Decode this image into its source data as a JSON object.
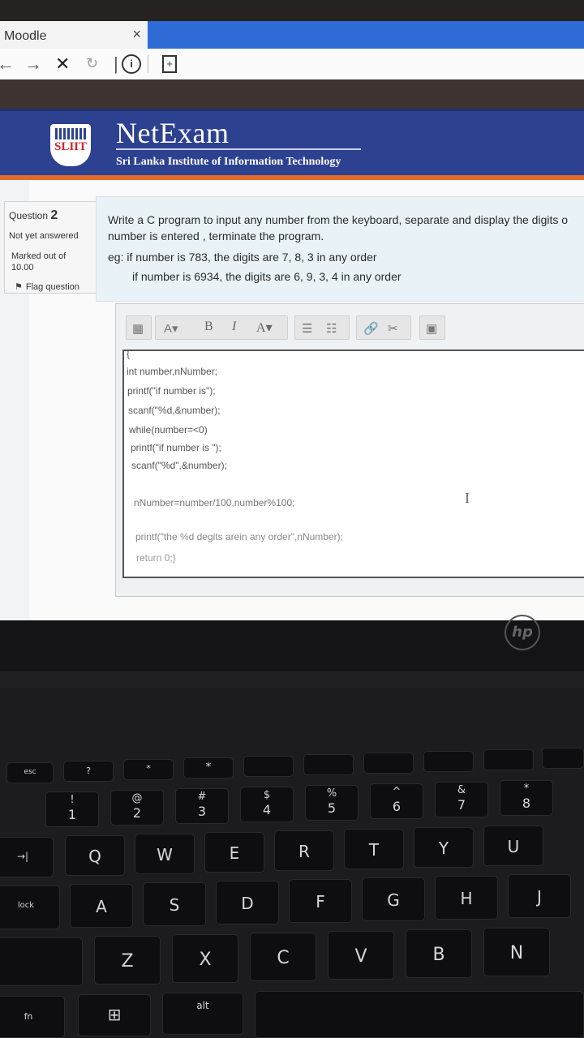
{
  "browser": {
    "tab_title": "Moodle",
    "close_glyph": "×",
    "nav_icons": [
      "back-arrow-icon",
      "forward-arrow-icon",
      "stop-icon",
      "reload-icon",
      "info-icon",
      "bookmark-add-icon"
    ]
  },
  "header": {
    "logo_text": "SLIIT",
    "brand": "NetExam",
    "subtitle": "Sri Lanka Institute of Information Technology",
    "colors": {
      "banner": "#2d4191",
      "accent": "#e16b2a"
    }
  },
  "question_info": {
    "label": "Question",
    "number": "2",
    "state": "Not yet answered",
    "marked": "Marked out of",
    "marks": "10.00",
    "flag": "Flag question"
  },
  "question": {
    "line1": "Write a C program to input any number from the keyboard, separate and display the digits o",
    "line2": "number is entered , terminate the program.",
    "example1": "eg: if number is 783, the digits are 7, 8, 3 in any order",
    "example2": "if number is 6934, the digits are 6, 9, 3, 4 in any order"
  },
  "editor": {
    "toolbar": {
      "bold": "B",
      "italic": "I",
      "font_color": "A",
      "paragraph": "A",
      "icons": [
        "toggle-toolbar-icon",
        "paragraph-style-icon",
        "bold-icon",
        "italic-icon",
        "font-color-icon",
        "unordered-list-icon",
        "ordered-list-icon",
        "link-icon",
        "unlink-icon",
        "image-icon"
      ]
    },
    "code_lines": [
      "{",
      "int number,nNumber;",
      "printf(\"if number is\");",
      "scanf(\"%d,&number);",
      "while(number=<0)",
      "printf(\"if number is \");",
      "scanf(\"%d\",&number);",
      "",
      "nNumber=number/100,number%100;",
      "",
      "printf(\"the %d degits arein any order\",nNumber);",
      "return 0;}"
    ]
  },
  "keyboard": {
    "row_fn": [
      "esc",
      "?",
      "*",
      "*",
      "",
      "",
      "",
      "",
      "",
      ""
    ],
    "row_num": [
      {
        "top": "!",
        "main": "1"
      },
      {
        "top": "@",
        "main": "2"
      },
      {
        "top": "#",
        "main": "3"
      },
      {
        "top": "$",
        "main": "4"
      },
      {
        "top": "%",
        "main": "5"
      },
      {
        "top": "^",
        "main": "6"
      },
      {
        "top": "&",
        "main": "7"
      },
      {
        "top": "*",
        "main": "8"
      }
    ],
    "row_q": [
      "Q",
      "W",
      "E",
      "R",
      "T",
      "Y",
      "U"
    ],
    "row_a": [
      "A",
      "S",
      "D",
      "F",
      "G",
      "H",
      "J"
    ],
    "row_z": [
      "Z",
      "X",
      "C",
      "V",
      "B",
      "N"
    ],
    "left_labels": {
      "tab": "→|",
      "lock": "lock",
      "fn": "fn",
      "alt": "alt"
    },
    "brand": "hp"
  }
}
